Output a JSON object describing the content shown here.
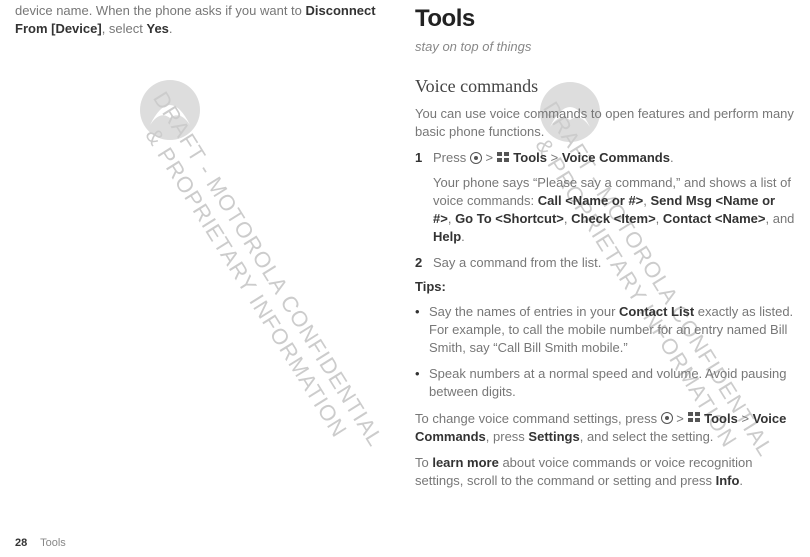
{
  "left": {
    "line1_a": "device name. When the phone asks if you want to ",
    "line1_b": "Disconnect From [Device]",
    "line1_c": ", select ",
    "line1_d": "Yes",
    "line1_e": "."
  },
  "right": {
    "title": "Tools",
    "tagline": "stay on top of things",
    "sub": "Voice commands",
    "intro": "You can use voice commands to open features and perform many basic phone functions.",
    "step1_a": "Press ",
    "step1_b": " > ",
    "step1_c": " Tools",
    "step1_d": " > ",
    "step1_e": "Voice Commands",
    "step1_f": ".",
    "step1_body_a": "Your phone says “Please say a command,” and shows a list of voice commands: ",
    "cmd1": "Call <Name or #>",
    "sep": ", ",
    "cmd2": "Send Msg <Name or #>",
    "cmd3": "Go To <Shortcut>",
    "cmd4": "Check <Item>",
    "cmd5": "Contact <Name>",
    "and": ", and ",
    "cmd6": "Help",
    "period": ".",
    "step2": "Say a command from the list.",
    "tips": "Tips:",
    "b1_a": "Say the names of entries in your ",
    "b1_b": "Contact List",
    "b1_c": " exactly as listed. For example, to call the mobile number for an entry named Bill Smith, say “Call Bill Smith mobile.”",
    "b2": "Speak numbers at a normal speed and volume. Avoid pausing between digits.",
    "p3_a": "To change voice command settings, press ",
    "p3_b": " > ",
    "p3_c": " Tools",
    "p3_d": " > ",
    "p3_e": "Voice Commands",
    "p3_f": ", press ",
    "p3_g": "Settings",
    "p3_h": ", and select the setting.",
    "p4_a": "To ",
    "p4_b": "learn more",
    "p4_c": " about voice commands or voice recognition settings, scroll to the command or setting and press ",
    "p4_d": "Info",
    "p4_e": "."
  },
  "footer": {
    "page": "28",
    "section": "Tools"
  },
  "watermark": "DRAFT - MOTOROLA CONFIDENTIAL & PROPRIETARY INFORMATION"
}
